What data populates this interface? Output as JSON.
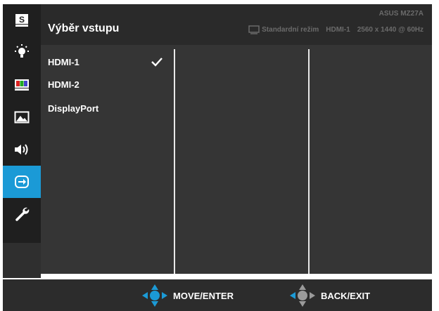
{
  "colors": {
    "accent": "#1b9ad6",
    "panel_bg": "#353535",
    "sidebar_bg": "#1f1f1f"
  },
  "header": {
    "title": "Výběr vstupu",
    "model": "ASUS MZ27A",
    "mode": "Standardní režim",
    "input": "HDMI-1",
    "resolution": "2560 x 1440 @ 60Hz"
  },
  "sidebar": {
    "items": [
      {
        "icon": "splendid-s-icon",
        "name": "Splendid"
      },
      {
        "icon": "brightness-bulb-icon",
        "name": "Eye Care"
      },
      {
        "icon": "color-bars-icon",
        "name": "Color"
      },
      {
        "icon": "image-icon",
        "name": "Image"
      },
      {
        "icon": "speaker-icon",
        "name": "Sound"
      },
      {
        "icon": "input-select-icon",
        "name": "Input Select",
        "active": true
      },
      {
        "icon": "wrench-icon",
        "name": "System Setup"
      }
    ]
  },
  "input_options": [
    {
      "label": "HDMI-1",
      "selected": true
    },
    {
      "label": "HDMI-2",
      "selected": false
    },
    {
      "label": "DisplayPort",
      "selected": false
    }
  ],
  "footer": {
    "move_enter": "MOVE/ENTER",
    "back_exit": "BACK/EXIT"
  }
}
